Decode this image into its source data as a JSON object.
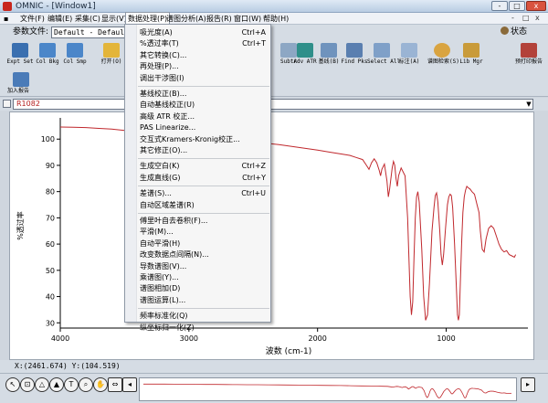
{
  "window": {
    "title": "OMNIC - [Window1]",
    "controls": [
      "-",
      "□",
      "x"
    ]
  },
  "menubar": {
    "items": [
      {
        "label": "文件(F)"
      },
      {
        "label": "编辑(E)"
      },
      {
        "label": "采集(C)"
      },
      {
        "label": "显示(V)"
      },
      {
        "label": "数据处理(P)"
      },
      {
        "label": "谱图分析(A)"
      },
      {
        "label": "报告(R)"
      },
      {
        "label": "窗口(W)"
      },
      {
        "label": "帮助(H)"
      }
    ],
    "active_index": 4,
    "right_controls": [
      "-",
      "□",
      "x"
    ]
  },
  "params": {
    "label": "参数文件:",
    "value": "Default - Default",
    "status_label": "状态"
  },
  "toolbar": {
    "buttons": [
      {
        "label": "Expt Set"
      },
      {
        "label": "Col Bkg"
      },
      {
        "label": "Col Smp"
      },
      {
        "label": "打开(O)"
      },
      {
        "label": "Subtr"
      },
      {
        "label": "Adv ATR"
      },
      {
        "label": "基线(B)"
      },
      {
        "label": "Find Pks"
      },
      {
        "label": "Select All"
      },
      {
        "label": "标注(A)"
      },
      {
        "label": "谱图检索(S)"
      },
      {
        "label": "Lib Mgr"
      },
      {
        "label": "预打印报告"
      }
    ],
    "row2": [
      {
        "label": "加入报告"
      }
    ]
  },
  "spectrum": {
    "selected": "R1082"
  },
  "dropdown": {
    "items": [
      {
        "label": "吸光度(A)",
        "shortcut": "Ctrl+A"
      },
      {
        "label": "%透过率(T)",
        "shortcut": "Ctrl+T"
      },
      {
        "label": "其它转换(C)...",
        "shortcut": ""
      },
      {
        "label": "再处理(P)...",
        "shortcut": ""
      },
      {
        "label": "调出干涉图(I)",
        "shortcut": ""
      },
      {
        "sep": true
      },
      {
        "label": "基线校正(B)...",
        "shortcut": ""
      },
      {
        "label": "自动基线校正(U)",
        "shortcut": ""
      },
      {
        "label": "高级 ATR 校正...",
        "shortcut": ""
      },
      {
        "label": "PAS Linearize...",
        "shortcut": ""
      },
      {
        "label": "交互式Kramers-Kronig校正...",
        "shortcut": ""
      },
      {
        "label": "其它修正(O)...",
        "shortcut": ""
      },
      {
        "sep": true
      },
      {
        "label": "生成空白(K)",
        "shortcut": "Ctrl+Z"
      },
      {
        "label": "生成直线(G)",
        "shortcut": "Ctrl+Y"
      },
      {
        "sep": true
      },
      {
        "label": "差谱(S)...",
        "shortcut": "Ctrl+U"
      },
      {
        "label": "自动区域差谱(R)",
        "shortcut": ""
      },
      {
        "sep": true
      },
      {
        "label": "傅里叶自去卷积(F)...",
        "shortcut": ""
      },
      {
        "label": "平滑(M)...",
        "shortcut": ""
      },
      {
        "label": "自动平滑(H)",
        "shortcut": ""
      },
      {
        "label": "改变数据点间隔(N)...",
        "shortcut": ""
      },
      {
        "label": "导数谱图(V)...",
        "shortcut": ""
      },
      {
        "label": "乘谱图(Y)...",
        "shortcut": ""
      },
      {
        "label": "谱图相加(D)",
        "shortcut": ""
      },
      {
        "label": "谱图运算(L)...",
        "shortcut": ""
      },
      {
        "sep": true
      },
      {
        "label": "频率标准化(Q)",
        "shortcut": ""
      },
      {
        "label": "纵坐标归一化(Z)",
        "shortcut": ""
      }
    ]
  },
  "plot": {
    "ylabel": "%透过率",
    "xlabel": "波数 (cm-1)",
    "xticks": [
      4000,
      3000,
      2000,
      1000
    ],
    "yticks": [
      30,
      40,
      50,
      60,
      70,
      80,
      90,
      100
    ],
    "xlim": [
      4000,
      450
    ],
    "ylim": [
      28,
      106
    ],
    "line_color": "#c0282d",
    "points": [
      [
        4000,
        104.6
      ],
      [
        3900,
        104.5
      ],
      [
        3800,
        104.4
      ],
      [
        3700,
        104.1
      ],
      [
        3600,
        103.8
      ],
      [
        3500,
        103.3
      ],
      [
        3400,
        102.8
      ],
      [
        3300,
        102.4
      ],
      [
        3200,
        102.0
      ],
      [
        3100,
        101.6
      ],
      [
        3000,
        101.2
      ],
      [
        2900,
        100.9
      ],
      [
        2800,
        100.5
      ],
      [
        2700,
        100.1
      ],
      [
        2600,
        99.6
      ],
      [
        2500,
        99.1
      ],
      [
        2400,
        98.4
      ],
      [
        2300,
        97.9
      ],
      [
        2200,
        97.2
      ],
      [
        2100,
        96.5
      ],
      [
        2000,
        95.8
      ],
      [
        1900,
        95.0
      ],
      [
        1800,
        94.2
      ],
      [
        1750,
        93.8
      ],
      [
        1700,
        93.0
      ],
      [
        1650,
        92.2
      ],
      [
        1620,
        90.0
      ],
      [
        1600,
        88.5
      ],
      [
        1580,
        91.0
      ],
      [
        1560,
        92.5
      ],
      [
        1540,
        91.0
      ],
      [
        1520,
        88.0
      ],
      [
        1510,
        86.0
      ],
      [
        1500,
        88.5
      ],
      [
        1480,
        90.5
      ],
      [
        1460,
        84.0
      ],
      [
        1450,
        78.0
      ],
      [
        1440,
        81.0
      ],
      [
        1420,
        89.0
      ],
      [
        1410,
        91.5
      ],
      [
        1400,
        90.0
      ],
      [
        1390,
        85.0
      ],
      [
        1380,
        82.0
      ],
      [
        1370,
        86.0
      ],
      [
        1350,
        89.0
      ],
      [
        1320,
        86.0
      ],
      [
        1300,
        70.0
      ],
      [
        1290,
        55.0
      ],
      [
        1280,
        40.0
      ],
      [
        1270,
        33.0
      ],
      [
        1260,
        38.0
      ],
      [
        1250,
        55.0
      ],
      [
        1240,
        70.0
      ],
      [
        1230,
        78.0
      ],
      [
        1220,
        80.0
      ],
      [
        1210,
        76.0
      ],
      [
        1190,
        58.0
      ],
      [
        1175,
        40.0
      ],
      [
        1160,
        31.0
      ],
      [
        1145,
        33.0
      ],
      [
        1130,
        45.0
      ],
      [
        1110,
        65.0
      ],
      [
        1095,
        74.0
      ],
      [
        1085,
        78.5
      ],
      [
        1075,
        79.5
      ],
      [
        1065,
        76.0
      ],
      [
        1050,
        65.0
      ],
      [
        1040,
        56.0
      ],
      [
        1030,
        52.0
      ],
      [
        1020,
        56.0
      ],
      [
        1005,
        66.0
      ],
      [
        990,
        75.0
      ],
      [
        980,
        78.0
      ],
      [
        970,
        79.0
      ],
      [
        960,
        78.5
      ],
      [
        950,
        74.0
      ],
      [
        935,
        60.0
      ],
      [
        922,
        45.0
      ],
      [
        912,
        33.0
      ],
      [
        905,
        31.0
      ],
      [
        898,
        33.0
      ],
      [
        890,
        45.0
      ],
      [
        880,
        60.0
      ],
      [
        870,
        72.0
      ],
      [
        860,
        78.0
      ],
      [
        850,
        80.5
      ],
      [
        840,
        82.0
      ],
      [
        830,
        81.5
      ],
      [
        815,
        81.0
      ],
      [
        800,
        80.0
      ],
      [
        780,
        79.0
      ],
      [
        760,
        75.0
      ],
      [
        745,
        72.0
      ],
      [
        735,
        65.0
      ],
      [
        720,
        58.0
      ],
      [
        705,
        57.0
      ],
      [
        690,
        62.0
      ],
      [
        670,
        66.0
      ],
      [
        650,
        67.0
      ],
      [
        630,
        66.0
      ],
      [
        610,
        63.0
      ],
      [
        590,
        60.0
      ],
      [
        570,
        58.0
      ],
      [
        550,
        57.0
      ],
      [
        530,
        57.5
      ],
      [
        510,
        56.0
      ],
      [
        490,
        55.5
      ],
      [
        470,
        55.0
      ],
      [
        460,
        56.0
      ]
    ]
  },
  "coords": {
    "text": "X:(2461.674) Y:(104.519)"
  },
  "nav": {
    "icons": [
      "cursor-arrow-icon",
      "region-icon",
      "peak-height-icon",
      "peak-area-icon",
      "annotate-icon",
      "zoom-icon",
      "hand-icon",
      "expand-icon",
      "scroll-left-icon",
      "scroll-right-icon"
    ]
  }
}
